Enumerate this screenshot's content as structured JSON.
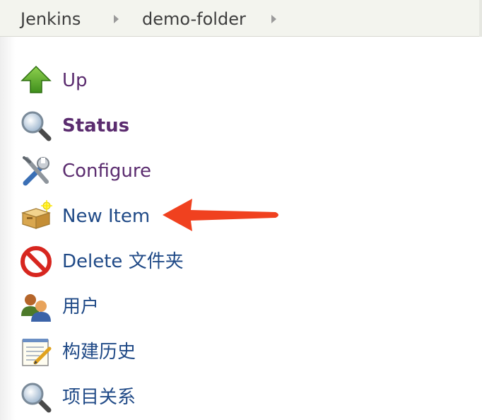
{
  "breadcrumb": {
    "items": [
      {
        "label": "Jenkins"
      },
      {
        "label": "demo-folder"
      }
    ]
  },
  "tasks": [
    {
      "label": "Up",
      "icon": "up-arrow-icon",
      "style": "visited"
    },
    {
      "label": "Status",
      "icon": "magnifier-icon",
      "style": "visited-bold"
    },
    {
      "label": "Configure",
      "icon": "tools-icon",
      "style": "visited"
    },
    {
      "label": "New Item",
      "icon": "package-icon",
      "style": "link"
    },
    {
      "label": "Delete 文件夹",
      "icon": "no-entry-icon",
      "style": "link"
    },
    {
      "label": "用户",
      "icon": "users-icon",
      "style": "link"
    },
    {
      "label": "构建历史",
      "icon": "notepad-icon",
      "style": "link"
    },
    {
      "label": "项目关系",
      "icon": "magnifier-icon",
      "style": "link"
    }
  ],
  "colors": {
    "visited_link": "#5b2c6f",
    "link": "#204a87",
    "annotation_arrow": "#f0411f"
  }
}
